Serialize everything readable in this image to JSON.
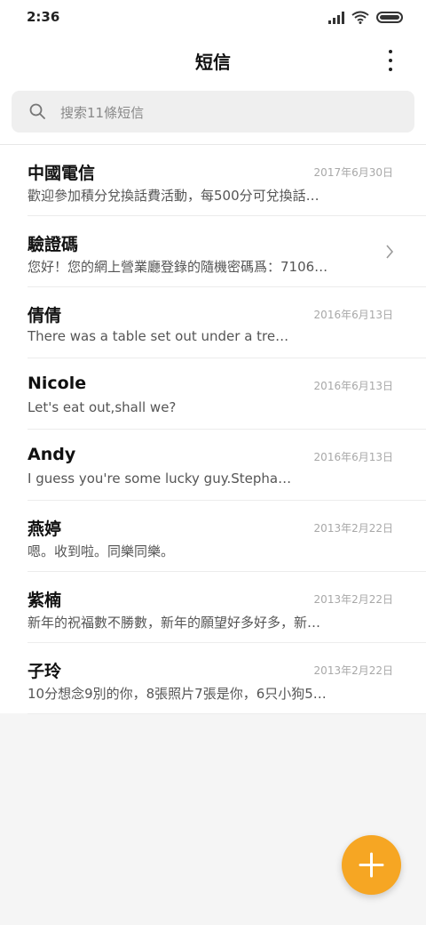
{
  "status_bar": {
    "time": "2:36",
    "icons": [
      "signal-icon",
      "wifi-icon",
      "battery-icon"
    ]
  },
  "header": {
    "title": "短信",
    "menu_icon": "more-vert-icon"
  },
  "search": {
    "placeholder": "搜索11條短信",
    "icon": "search-icon"
  },
  "conversations": [
    {
      "name": "中國電信",
      "date": "2017年6月30日",
      "preview": "歡迎參加積分兌換話費活動，每500分可兌換話…"
    },
    {
      "name": "驗證碼",
      "date": "",
      "preview": "您好！您的網上營業廳登錄的隨機密碼爲：7106…",
      "icon": "chevron-right-icon"
    },
    {
      "name": "倩倩",
      "date": "2016年6月13日",
      "preview": "There was a table set out under a tre…"
    },
    {
      "name": "Nicole",
      "date": "2016年6月13日",
      "preview": "Let's eat out,shall we?"
    },
    {
      "name": "Andy",
      "date": "2016年6月13日",
      "preview": "I guess you're some lucky guy.Stepha…"
    },
    {
      "name": "燕婷",
      "date": "2013年2月22日",
      "preview": "嗯。收到啦。同樂同樂。"
    },
    {
      "name": "紫楠",
      "date": "2013年2月22日",
      "preview": "新年的祝福數不勝數，新年的願望好多好多，新…"
    },
    {
      "name": "子玲",
      "date": "2013年2月22日",
      "preview": "10分想念9別的你，8張照片7張是你，6只小狗5…"
    }
  ],
  "fab": {
    "icon": "plus-icon"
  },
  "colors": {
    "accent": "#f6a623",
    "background": "#f5f5f5",
    "surface": "#ffffff"
  }
}
